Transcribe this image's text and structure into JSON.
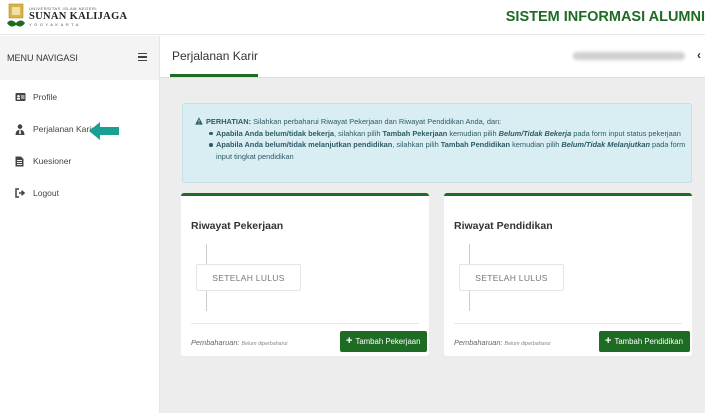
{
  "header": {
    "logo_small": "UNIVERSITAS ISLAM NEGERI",
    "logo_name": "SUNAN KALIJAGA",
    "logo_city": "YOGYAKARTA",
    "app_title": "SISTEM INFORMASI ALUMNI"
  },
  "sidebar": {
    "heading": "MENU NAVIGASI",
    "items": [
      {
        "label": "Profile",
        "icon": "id-card-icon"
      },
      {
        "label": "Perjalanan Karir",
        "icon": "user-tie-icon"
      },
      {
        "label": "Kuesioner",
        "icon": "document-icon"
      },
      {
        "label": "Logout",
        "icon": "sign-out-icon"
      }
    ]
  },
  "tabbar": {
    "title": "Perjalanan Karir"
  },
  "alert": {
    "strong": "PERHATIAN:",
    "text": " Silahkan perbaharui Riwayat Pekerjaan dan Riwayat Pendidikan Anda, dan:",
    "b1_a": "Apabila Anda belum/tidak bekerja",
    "b1_b": ", silahkan pilih ",
    "b1_c": "Tambah Pekerjaan",
    "b1_d": " kemudian pilih ",
    "b1_e": "Belum/Tidak Bekerja",
    "b1_f": " pada form input status pekerjaan",
    "b2_a": "Apabila Anda belum/tidak melanjutkan pendidikan",
    "b2_b": ", silahkan pilih ",
    "b2_c": "Tambah Pendidikan",
    "b2_d": " kemudian pilih ",
    "b2_e": "Belum/Tidak Melanjutkan",
    "b2_f": " pada form",
    "b2_g": "input tingkat pendidikan"
  },
  "cards": {
    "work": {
      "title": "Riwayat Pekerjaan",
      "timeline_label": "SETELAH LULUS",
      "updated_label": "Pembaharuan:",
      "updated_value": "Belum diperbaharui",
      "button": "Tambah Pekerjaan"
    },
    "education": {
      "title": "Riwayat Pendidikan",
      "timeline_label": "SETELAH LULUS",
      "updated_label": "Pembaharuan:",
      "updated_value": "Belum diperbaharui",
      "button": "Tambah Pendidikan"
    }
  },
  "colors": {
    "brand_green": "#1e6b23",
    "alert_bg": "#d8eef3",
    "arrow_teal": "#1aa093",
    "content_bg": "#ededed"
  }
}
